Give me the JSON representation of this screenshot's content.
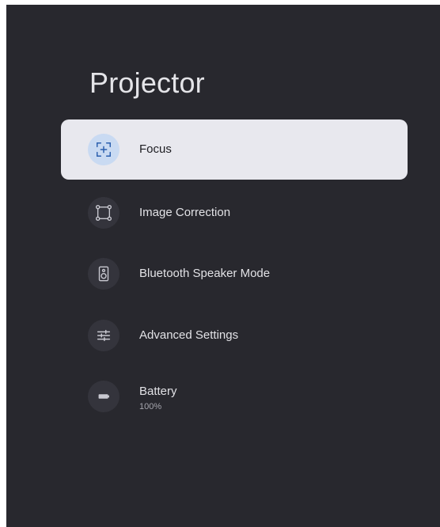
{
  "screen": {
    "title": "Projector"
  },
  "menu": {
    "items": [
      {
        "label": "Focus",
        "icon": "focus-icon",
        "selected": true
      },
      {
        "label": "Image Correction",
        "icon": "image-correction-icon",
        "selected": false
      },
      {
        "label": "Bluetooth Speaker Mode",
        "icon": "speaker-icon",
        "selected": false
      },
      {
        "label": "Advanced Settings",
        "icon": "sliders-icon",
        "selected": false
      },
      {
        "label": "Battery",
        "sublabel": "100%",
        "icon": "battery-icon",
        "selected": false
      }
    ]
  },
  "colors": {
    "background": "#28282e",
    "selected_item": "#e8e8ee",
    "selected_icon_bg": "#c9daf2",
    "selected_icon": "#2b5fae",
    "icon_bg": "#34343c",
    "icon": "#c8c8d0",
    "text": "#e2e2e6"
  }
}
